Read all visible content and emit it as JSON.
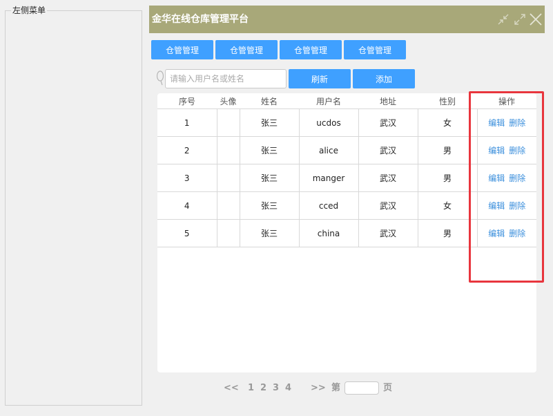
{
  "left_menu": {
    "title": "左侧菜单"
  },
  "window": {
    "title": "金华在线仓库管理平台"
  },
  "categories": [
    {
      "label": "仓管管理"
    },
    {
      "label": "仓管管理"
    },
    {
      "label": "仓管管理"
    },
    {
      "label": "仓管管理"
    }
  ],
  "search": {
    "placeholder": "请输入用户名或姓名",
    "value": ""
  },
  "actions": {
    "refresh": "刷新",
    "add": "添加"
  },
  "table": {
    "headers": [
      "序号",
      "头像",
      "姓名",
      "用户名",
      "地址",
      "性别",
      "操作"
    ],
    "rows": [
      {
        "id": "1",
        "avatar": "",
        "name": "张三",
        "username": "ucdos",
        "address": "武汉",
        "gender": "女"
      },
      {
        "id": "2",
        "avatar": "",
        "name": "张三",
        "username": "alice",
        "address": "武汉",
        "gender": "男"
      },
      {
        "id": "3",
        "avatar": "",
        "name": "张三",
        "username": "manger",
        "address": "武汉",
        "gender": "男"
      },
      {
        "id": "4",
        "avatar": "",
        "name": "张三",
        "username": "cced",
        "address": "武汉",
        "gender": "女"
      },
      {
        "id": "5",
        "avatar": "",
        "name": "张三",
        "username": "china",
        "address": "武汉",
        "gender": "男"
      }
    ],
    "edit_label": "编辑",
    "delete_label": "删除"
  },
  "pagination": {
    "prev": "<<",
    "pages": [
      "1",
      "2",
      "3",
      "4"
    ],
    "next": ">>",
    "before_input": "第",
    "after_input": "页",
    "page_value": ""
  },
  "colors": {
    "titlebar": "#a8a879",
    "button": "#3fa0ff",
    "link": "#3b8fdc",
    "highlight": "#e8353d"
  }
}
